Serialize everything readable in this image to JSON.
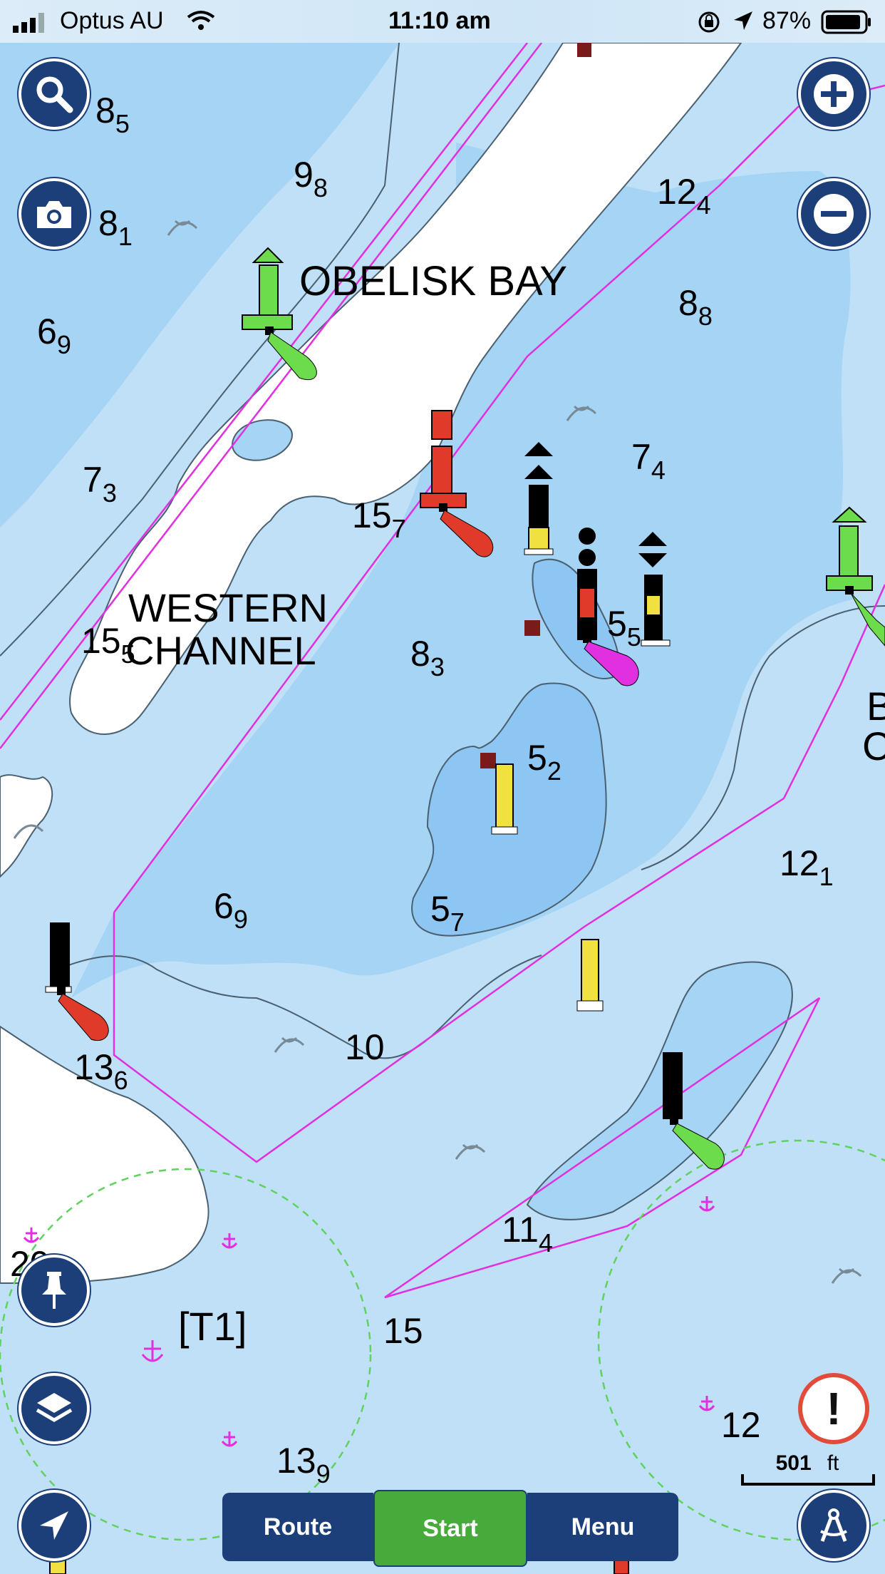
{
  "status_bar": {
    "carrier": "Optus AU",
    "time": "11:10 am",
    "battery": "87%"
  },
  "map": {
    "place_labels": [
      {
        "id": "obelisk-bay",
        "text": "OBELISK BAY"
      },
      {
        "id": "western-channel-line1",
        "text": "WESTERN"
      },
      {
        "id": "western-channel-line2",
        "text": "CHANNEL"
      },
      {
        "id": "area-t1",
        "text": "[T1]"
      },
      {
        "id": "edge-b",
        "text": "B"
      },
      {
        "id": "edge-c",
        "text": "C"
      }
    ],
    "soundings": [
      {
        "main": "8",
        "sub": "5"
      },
      {
        "main": "9",
        "sub": "8"
      },
      {
        "main": "12",
        "sub": "4"
      },
      {
        "main": "8",
        "sub": "1"
      },
      {
        "main": "8",
        "sub": "8"
      },
      {
        "main": "6",
        "sub": "9"
      },
      {
        "main": "7",
        "sub": "4"
      },
      {
        "main": "7",
        "sub": "3"
      },
      {
        "main": "15",
        "sub": "7"
      },
      {
        "main": "15",
        "sub": "5"
      },
      {
        "main": "8",
        "sub": "3"
      },
      {
        "main": "5",
        "sub": "5"
      },
      {
        "main": "5",
        "sub": "2"
      },
      {
        "main": "12",
        "sub": "1"
      },
      {
        "main": "6",
        "sub": "9"
      },
      {
        "main": "5",
        "sub": "7"
      },
      {
        "main": "10",
        "sub": ""
      },
      {
        "main": "13",
        "sub": "6"
      },
      {
        "main": "11",
        "sub": "4"
      },
      {
        "main": "15",
        "sub": ""
      },
      {
        "main": "12",
        "sub": ""
      },
      {
        "main": "13",
        "sub": "9"
      },
      {
        "main": "20",
        "sub": ""
      }
    ]
  },
  "controls": {
    "search": "search-icon",
    "camera": "camera-icon",
    "zoom_in": "plus-icon",
    "zoom_out": "minus-icon",
    "pin": "pushpin-icon",
    "layers": "layers-icon",
    "locate": "navigation-arrow-icon",
    "alert": "!",
    "compass": "compass-icon"
  },
  "bottom_bar": {
    "route_label": "Route",
    "start_label": "Start",
    "menu_label": "Menu"
  },
  "scale": {
    "value": "501",
    "unit": "ft"
  },
  "colors": {
    "land": "#ffffff",
    "deep_water": "#bfe0f6",
    "shallow_water": "#a6d4f4",
    "very_shallow": "#8dc6f2",
    "track_magenta": "#e030e0",
    "buoy_green": "#6ddc4c",
    "buoy_red": "#e03a2a",
    "button_navy": "#1d3f79",
    "start_green": "#47ab3c"
  }
}
